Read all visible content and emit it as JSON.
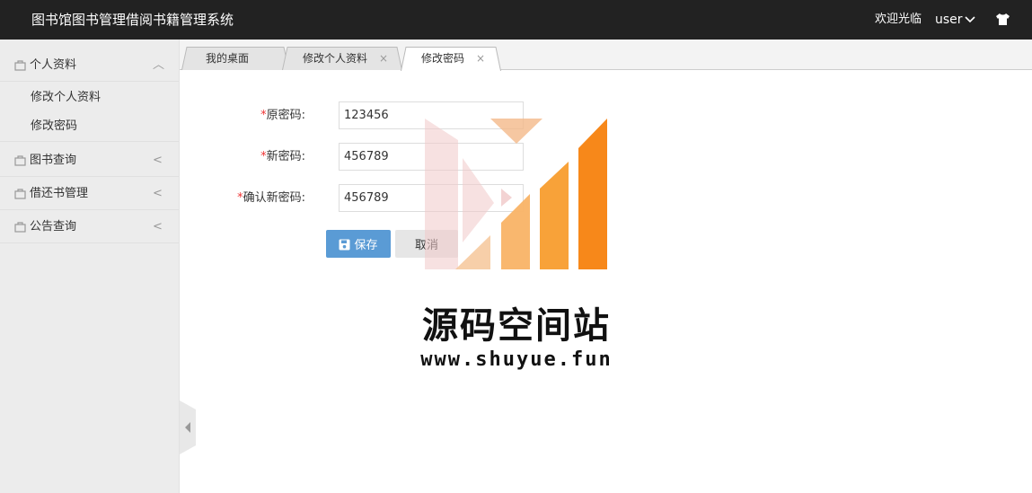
{
  "header": {
    "title": "图书馆图书管理借阅书籍管理系统",
    "welcome": "欢迎光临",
    "user": "user"
  },
  "sidebar": {
    "groups": [
      {
        "label": "个人资料",
        "arrow": "︿",
        "children": [
          "修改个人资料",
          "修改密码"
        ]
      },
      {
        "label": "图书查询",
        "arrow": "<"
      },
      {
        "label": "借还书管理",
        "arrow": "<"
      },
      {
        "label": "公告查询",
        "arrow": "<"
      }
    ]
  },
  "tabs": [
    {
      "label": "我的桌面"
    },
    {
      "label": "修改个人资料",
      "close": "×"
    },
    {
      "label": "修改密码",
      "close": "×",
      "active": true
    }
  ],
  "form": {
    "required_mark": "*",
    "fields": [
      {
        "label": "原密码:",
        "value": "123456"
      },
      {
        "label": "新密码:",
        "value": "456789"
      },
      {
        "label": "确认新密码:",
        "value": "456789"
      }
    ],
    "save_label": "保存",
    "cancel_label": "取消"
  },
  "watermark": {
    "name": "源码空间站",
    "url": "www.shuyue.fun"
  },
  "colors": {
    "header_bg": "#222222",
    "sidebar_bg": "#ececec",
    "save_button": "#5a9bd5",
    "required": "#e33333",
    "watermark_orange": "#f7941d"
  }
}
